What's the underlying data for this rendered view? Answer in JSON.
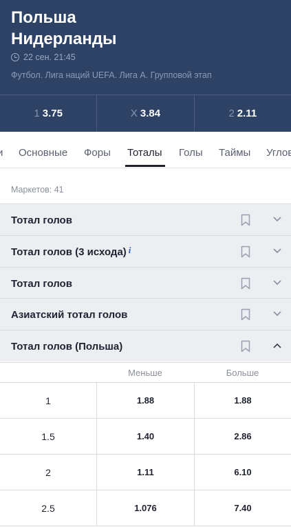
{
  "match": {
    "team1": "Польша",
    "team2": "Нидерланды",
    "datetime": "22 сен. 21:45",
    "league": "Футбол. Лига наций UEFA. Лига А. Групповой этап"
  },
  "odds": [
    {
      "label": "1",
      "value": "3.75"
    },
    {
      "label": "X",
      "value": "3.84"
    },
    {
      "label": "2",
      "value": "2.11"
    }
  ],
  "tabs": [
    {
      "label": "и"
    },
    {
      "label": "Основные"
    },
    {
      "label": "Форы"
    },
    {
      "label": "Тоталы",
      "active": true
    },
    {
      "label": "Голы"
    },
    {
      "label": "Таймы"
    },
    {
      "label": "Углов"
    }
  ],
  "markets_count": "Маркетов: 41",
  "markets": [
    {
      "title": "Тотал голов",
      "expanded": false
    },
    {
      "title": "Тотал голов (3 исхода)",
      "info_mark": "i",
      "expanded": false
    },
    {
      "title": "Тотал голов",
      "expanded": false
    },
    {
      "title": "Азиатский тотал голов",
      "expanded": false
    },
    {
      "title": "Тотал голов (Польша)",
      "expanded": true
    }
  ],
  "table": {
    "headers": {
      "under": "Меньше",
      "over": "Больше"
    },
    "rows": [
      {
        "total": "1",
        "under": "1.88",
        "over": "1.88"
      },
      {
        "total": "1.5",
        "under": "1.40",
        "over": "2.86"
      },
      {
        "total": "2",
        "under": "1.11",
        "over": "6.10"
      },
      {
        "total": "2.5",
        "under": "1.076",
        "over": "7.40"
      }
    ]
  },
  "colors": {
    "header_bg": "#2e4265",
    "market_bg": "#eceef2",
    "info_icon": "#2c5fb8"
  },
  "icons": {
    "clock": "clock-icon",
    "bookmark": "bookmark-icon",
    "chevron_down": "chevron-down-icon",
    "chevron_up": "chevron-up-icon",
    "info": "info-icon"
  }
}
